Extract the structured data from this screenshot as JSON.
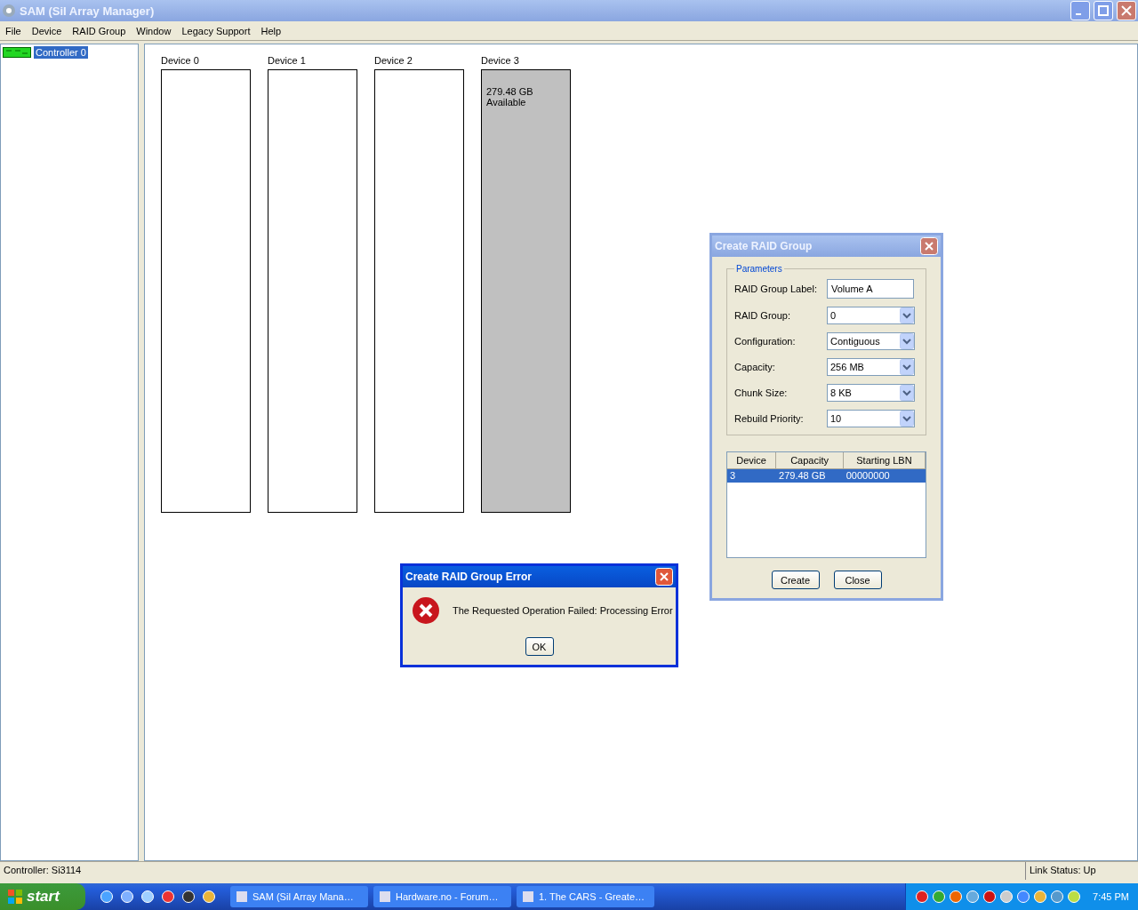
{
  "window": {
    "title": "SAM (SiI Array Manager)"
  },
  "menu": [
    "File",
    "Device",
    "RAID Group",
    "Window",
    "Legacy Support",
    "Help"
  ],
  "tree": [
    {
      "label": "Controller 0",
      "selected": true
    }
  ],
  "devices": [
    {
      "label": "Device 0",
      "selected": false
    },
    {
      "label": "Device 1",
      "selected": false
    },
    {
      "label": "Device 2",
      "selected": false
    },
    {
      "label": "Device 3",
      "selected": true,
      "capacity": "279.48 GB",
      "status": "Available"
    }
  ],
  "create_dialog": {
    "title": "Create RAID Group",
    "group_title": "Parameters",
    "fields": [
      {
        "kind": "text",
        "label": "RAID Group Label:",
        "value": "Volume A"
      },
      {
        "kind": "select",
        "label": "RAID Group:",
        "value": "0"
      },
      {
        "kind": "select",
        "label": "Configuration:",
        "value": "Contiguous"
      },
      {
        "kind": "select",
        "label": "Capacity:",
        "value": "256 MB"
      },
      {
        "kind": "select",
        "label": "Chunk Size:",
        "value": "8 KB"
      },
      {
        "kind": "select",
        "label": "Rebuild Priority:",
        "value": "10"
      }
    ],
    "table": {
      "columns": [
        "Device",
        "Capacity",
        "Starting LBN"
      ],
      "rows": [
        {
          "cells": [
            "3",
            "279.48 GB",
            "00000000"
          ],
          "selected": true
        }
      ]
    },
    "buttons": [
      "Create",
      "Close"
    ]
  },
  "error_dialog": {
    "title": "Create RAID Group Error",
    "message": "The Requested Operation Failed: Processing Error",
    "button": "OK"
  },
  "status_bar": {
    "left": "Controller: Si3114",
    "right": "Link Status: Up"
  },
  "taskbar": {
    "start": "start",
    "tasks": [
      {
        "label": "SAM (SiI Array Mana…",
        "selected": false
      },
      {
        "label": "Hardware.no - Forum…",
        "selected": false
      },
      {
        "label": "1. The CARS - Greate…",
        "selected": false
      }
    ],
    "clock": "7:45 PM"
  }
}
